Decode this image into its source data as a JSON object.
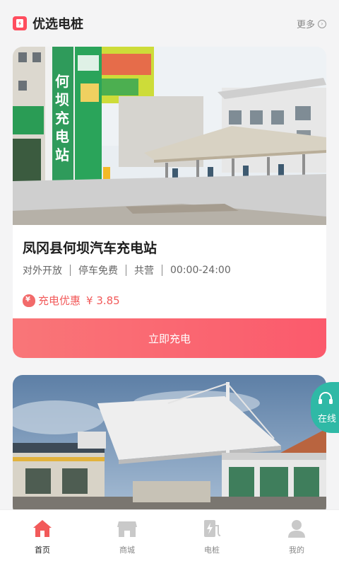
{
  "header": {
    "title": "优选电桩",
    "more_label": "更多",
    "icon": "charging-station-icon",
    "accent_color": "#ff4d5e"
  },
  "stations": [
    {
      "name": "凤冈县何坝汽车充电站",
      "tags": [
        "对外开放",
        "停车免费",
        "共营",
        "00:00-24:00"
      ],
      "discount_label": "充电优惠",
      "price": "¥ 3.85",
      "button_label": "立即充电",
      "sign_text": "何坝充电站"
    },
    {
      "name": "",
      "photo": "canopy-charging-station-photo"
    }
  ],
  "floating": {
    "label": "在线",
    "icon": "headset-icon"
  },
  "tabbar": {
    "items": [
      {
        "label": "首页",
        "icon": "home-icon",
        "active": true
      },
      {
        "label": "商城",
        "icon": "shop-icon",
        "active": false
      },
      {
        "label": "电桩",
        "icon": "charger-icon",
        "active": false
      },
      {
        "label": "我的",
        "icon": "user-icon",
        "active": false
      }
    ]
  },
  "colors": {
    "accent": "#fb5a6c",
    "float": "#2fb9a6"
  }
}
